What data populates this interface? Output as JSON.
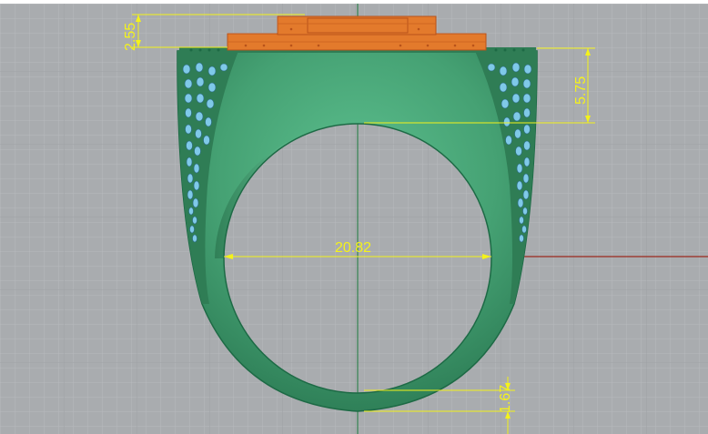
{
  "viewport": {
    "view_name": "Front",
    "colors": {
      "background": "#a9acaf",
      "grid_minor": "#b8bbbe",
      "grid_major": "#9ea2a6",
      "ring_body": "#4aa678",
      "ring_edge": "#1d6a45",
      "stone_setting": "#e37a2c",
      "pave_stones": "#7fc9e8",
      "dimension": "#f4f21a",
      "x_axis": "#9b2a1e",
      "y_axis": "#1b7a3c"
    }
  },
  "dimensions": {
    "top_setting_height": "2.55",
    "shoulder_height": "5.75",
    "inner_diameter": "20.82",
    "shank_thickness": "1.67"
  }
}
